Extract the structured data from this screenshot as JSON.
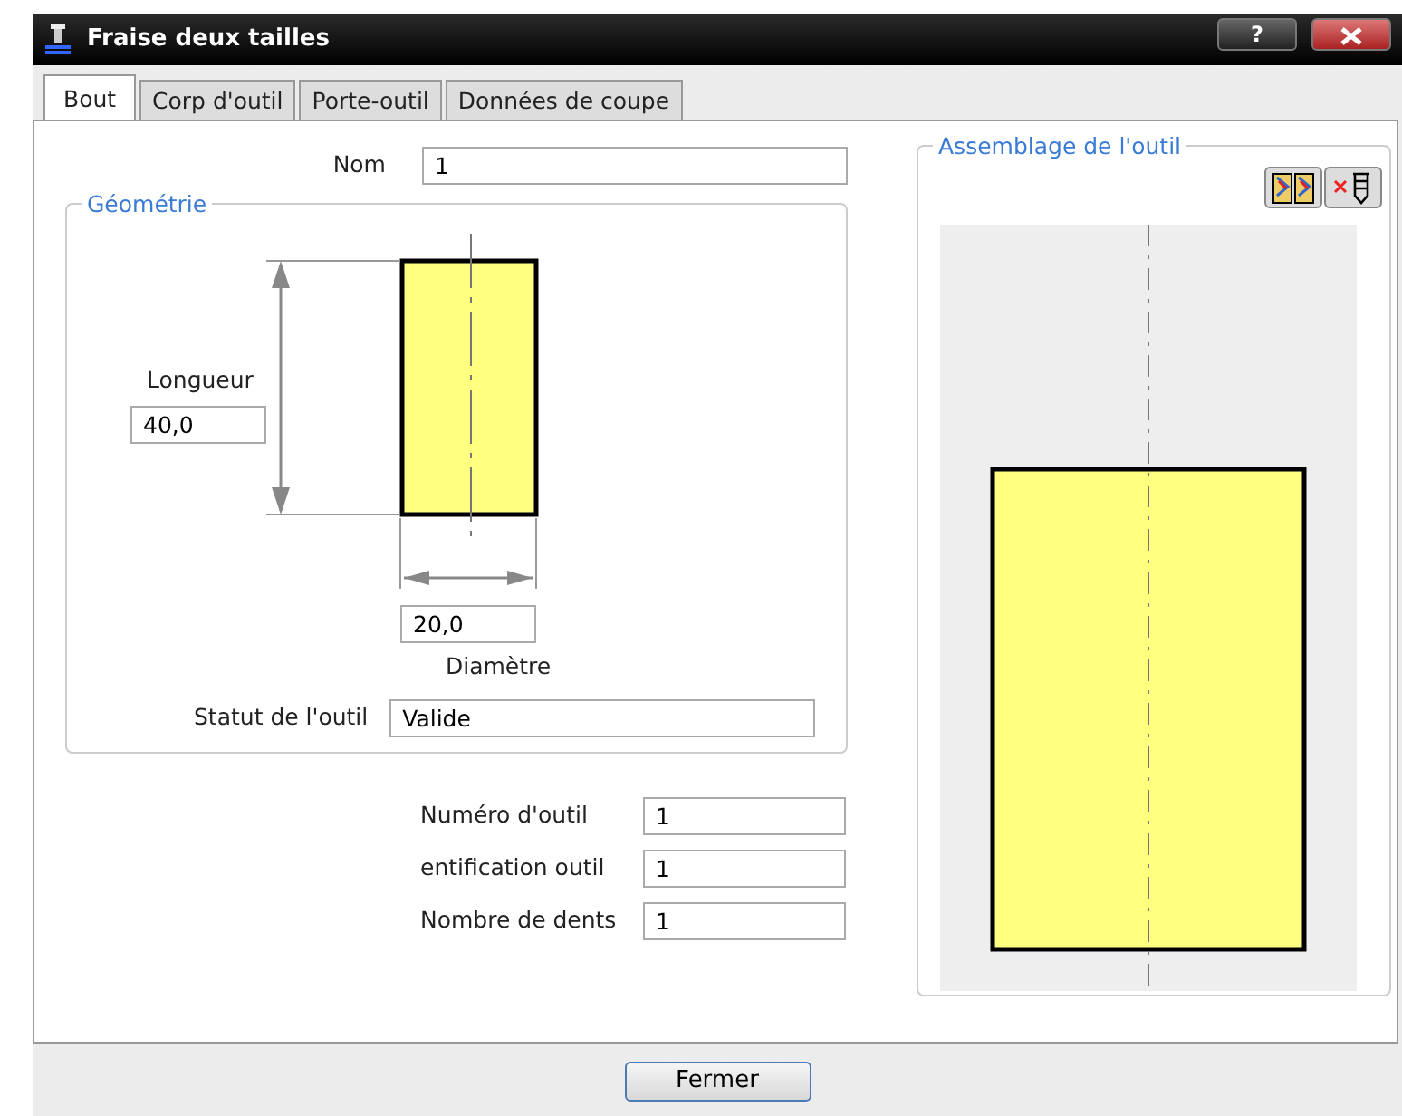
{
  "window": {
    "title": "Fraise deux tailles",
    "help_button": "?"
  },
  "tabs": [
    {
      "label": "Bout",
      "selected": true
    },
    {
      "label": "Corp d'outil",
      "selected": false
    },
    {
      "label": "Porte-outil",
      "selected": false
    },
    {
      "label": "Données de coupe",
      "selected": false
    }
  ],
  "name_field": {
    "label": "Nom",
    "value": "1"
  },
  "geometry": {
    "title": "Géométrie",
    "length_label": "Longueur",
    "length_value": "40,0",
    "diameter_value": "20,0",
    "diameter_label": "Diamètre",
    "status_label": "Statut de l'outil",
    "status_value": "Valide"
  },
  "tool_fields": [
    {
      "label": "Numéro d'outil",
      "value": "1"
    },
    {
      "label": "entification outil",
      "value": "1"
    },
    {
      "label": "Nombre de dents",
      "value": "1"
    }
  ],
  "assembly": {
    "title": "Assemblage de l'outil"
  },
  "footer_button": "Fermer"
}
